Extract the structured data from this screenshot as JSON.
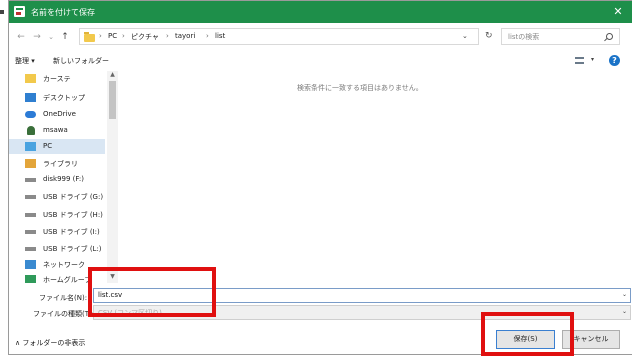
{
  "window": {
    "title": "名前を付けて保存",
    "close_glyph": "✕"
  },
  "nav": {
    "back_glyph": "←",
    "forward_glyph": "→",
    "recent_glyph": "⌄",
    "up_glyph": "↑",
    "breadcrumb": [
      "PC",
      "ピクチャ",
      "tayori",
      "list"
    ],
    "separator": "›",
    "addr_dropdown_glyph": "⌄",
    "refresh_glyph": "↻",
    "search_placeholder": "listの検索"
  },
  "toolbar": {
    "organize": "整理 ▾",
    "new_folder": "新しいフォルダー",
    "view_drop": "▾",
    "help_glyph": "?"
  },
  "sidebar": {
    "items": [
      {
        "label": "カーステ",
        "icon": "folder-icon"
      },
      {
        "label": "デスクトップ",
        "icon": "desktop-icon"
      },
      {
        "label": "OneDrive",
        "icon": "cloud-icon"
      },
      {
        "label": "msawa",
        "icon": "user-icon"
      },
      {
        "label": "PC",
        "icon": "pc-icon"
      },
      {
        "label": "ライブラリ",
        "icon": "library-icon"
      },
      {
        "label": "disk999 (F:)",
        "icon": "drive-icon"
      },
      {
        "label": "USB ドライブ (G:)",
        "icon": "drive-icon"
      },
      {
        "label": "USB ドライブ (H:)",
        "icon": "drive-icon"
      },
      {
        "label": "USB ドライブ (I:)",
        "icon": "drive-icon"
      },
      {
        "label": "USB ドライブ (L:)",
        "icon": "drive-icon"
      },
      {
        "label": "ネットワーク",
        "icon": "network-icon"
      },
      {
        "label": "ホームグループ",
        "icon": "homegroup-icon"
      }
    ],
    "selected": "PC",
    "scroll_up_glyph": "▲",
    "scroll_down_glyph": "▼"
  },
  "content": {
    "empty_message": "検索条件に一致する項目はありません。"
  },
  "filename": {
    "label": "ファイル名(N):",
    "value": "list.csv",
    "dropdown_glyph": "⌄"
  },
  "filetype": {
    "label": "ファイルの種類(T):",
    "value": "CSV (コンマ区切り)",
    "dropdown_glyph": "⌄"
  },
  "footer": {
    "hide_folders": "∧ フォルダーの非表示",
    "save": "保存(S)",
    "cancel": "キャンセル"
  },
  "colors": {
    "titlebar": "#1e8f4a",
    "highlight": "#e01010",
    "selected": "#d9e6f3"
  }
}
